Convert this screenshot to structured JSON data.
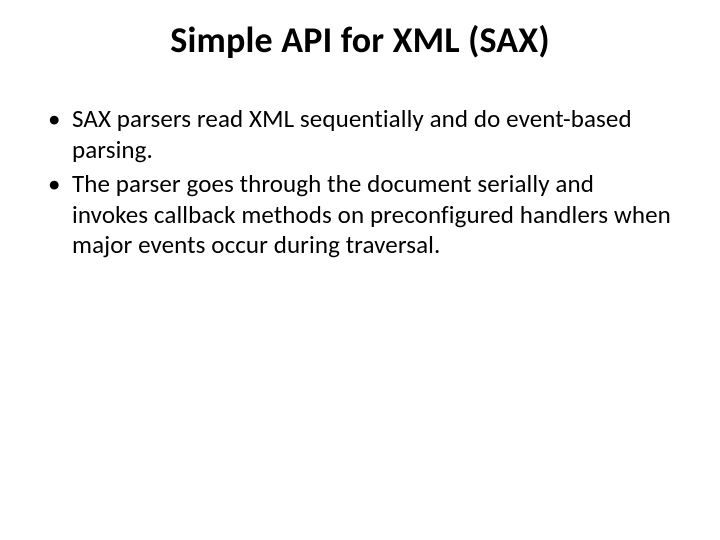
{
  "slide": {
    "title": "Simple API for XML (SAX)",
    "bullets": [
      "SAX parsers read XML sequentially and do event-based parsing.",
      "The parser goes through the document serially and invokes callback methods on preconfigured handlers when major events occur during traversal."
    ]
  }
}
